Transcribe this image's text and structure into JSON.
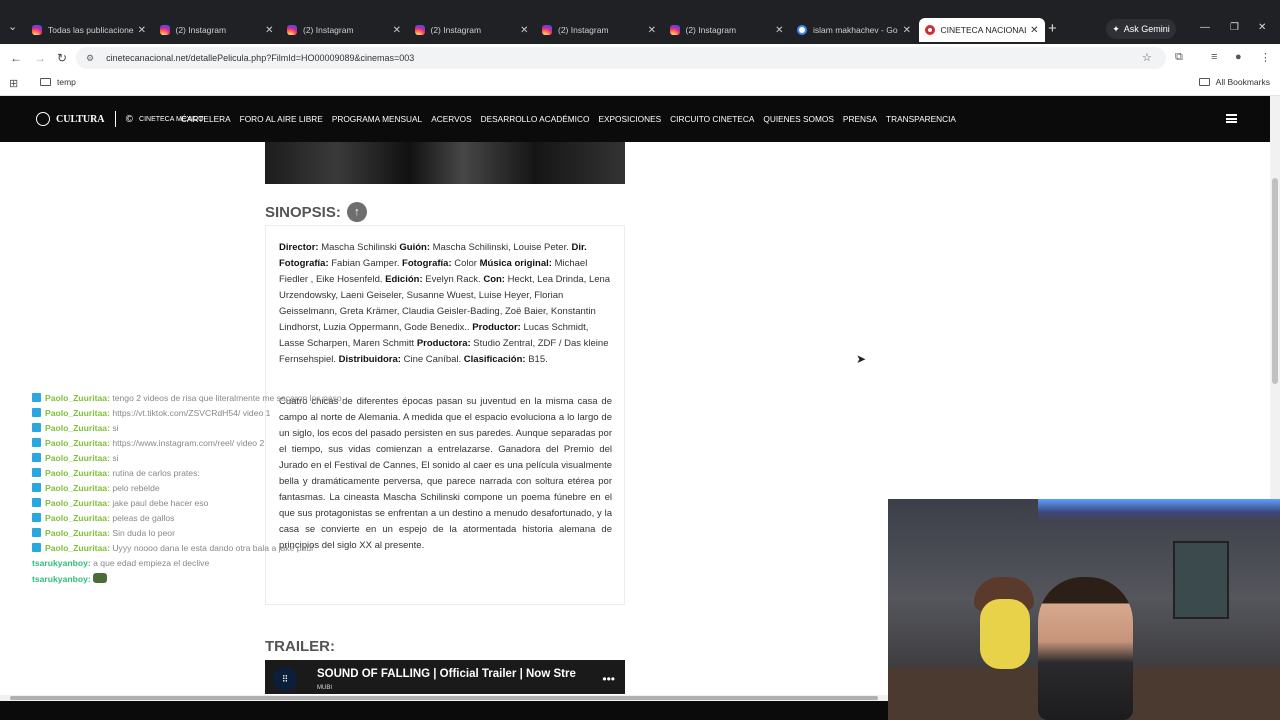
{
  "browser": {
    "tabs": [
      {
        "title": "Todas las publicaciones",
        "icon": "instagram-icon",
        "kind": "ig"
      },
      {
        "title": "(2) Instagram",
        "icon": "instagram-icon",
        "kind": "ig"
      },
      {
        "title": "(2) Instagram",
        "icon": "instagram-icon",
        "kind": "ig"
      },
      {
        "title": "(2) Instagram",
        "icon": "instagram-icon",
        "kind": "ig"
      },
      {
        "title": "(2) Instagram",
        "icon": "instagram-icon",
        "kind": "ig"
      },
      {
        "title": "(2) Instagram",
        "icon": "instagram-icon",
        "kind": "ig"
      },
      {
        "title": "islam makhachev - Go",
        "icon": "google-icon",
        "kind": "g"
      },
      {
        "title": "CINETECA NACIONAL",
        "icon": "cineteca-icon",
        "kind": "cn",
        "active": true
      }
    ],
    "ask_gemini": "Ask Gemini",
    "url": "cinetecanacional.net/detallePelicula.php?FilmId=HO00009089&cinemas=003",
    "bookmark_folder": "temp",
    "all_bookmarks": "All Bookmarks"
  },
  "site": {
    "logo_text": "CULTURA",
    "logo_sub": "CINETECA MÉXICO",
    "menu": [
      "CARTELERA",
      "FORO AL AIRE LIBRE",
      "PROGRAMA MENSUAL",
      "ACERVOS",
      "DESARROLLO ACADÉMICO",
      "EXPOSICIONES",
      "CIRCUITO CINETECA",
      "QUIENES SOMOS",
      "PRENSA",
      "TRANSPARENCIA"
    ]
  },
  "synopsis": {
    "heading": "SINOPSIS:",
    "credits": [
      {
        "label": "Director:",
        "value": " Mascha Schilinski "
      },
      {
        "label": "Guión:",
        "value": " Mascha Schilinski, Louise Peter. "
      },
      {
        "label": "Dir. Fotografía:",
        "value": " Fabian Gamper.  "
      },
      {
        "label": "Fotografía:",
        "value": " Color  "
      },
      {
        "label": "Música original:",
        "value": " Michael Fiedler , Eike Hosenfeld. "
      },
      {
        "label": "Edición:",
        "value": " Evelyn Rack. "
      },
      {
        "label": "Con:",
        "value": " Heckt, Lea Drinda, Lena Urzendowsky, Laeni Geiseler, Susanne Wuest, Luise Heyer, Florian Geisselmann, Greta Krämer, Claudia Geisler-Bading, Zoë Baier, Konstantin Lindhorst, Luzia Oppermann, Gode Benedix..  "
      },
      {
        "label": "Productor:",
        "value": " Lucas Schmidt, Lasse Scharpen, Maren Schmitt "
      },
      {
        "label": "Productora:",
        "value": " Studio Zentral, ZDF / Das kleine Fernsehspiel. "
      },
      {
        "label": "Distribuidora:",
        "value": " Cine Caníbal. "
      },
      {
        "label": "Clasificación:",
        "value": " B15."
      }
    ],
    "plot": "Cuatro chicas de diferentes épocas pasan su juventud en la misma casa de campo al norte de Alemania. A medida que el espacio evoluciona a lo largo de un siglo, los ecos del pasado persisten en sus paredes. Aunque separadas por el tiempo, sus vidas comienzan a entrelazarse. Ganadora del Premio del Jurado en el Festival de Cannes, El sonido al caer es una película visualmente bella y dramáticamente perversa, que parece narrada con soltura etérea por fantasmas. La cineasta Mascha Schilinski compone un poema fúnebre en el que sus protagonistas se enfrentan a un destino a menudo desafortunado, y la casa se convierte en un espejo de la atormentada historia alemana de principios del siglo XX al presente."
  },
  "trailer": {
    "heading": "TRAILER:",
    "video_title": "SOUND OF FALLING | Official Trailer | Now Stre",
    "channel": "MUBI"
  },
  "chat": [
    {
      "user": "Paolo_Zuuritaa:",
      "text": "tengo 2 videos de risa que literalmente me sacaron los paso",
      "u": 1
    },
    {
      "user": "Paolo_Zuuritaa:",
      "text": "https://vt.tiktok.com/ZSVCRdH54/ video 1",
      "u": 1
    },
    {
      "user": "Paolo_Zuuritaa:",
      "text": "si",
      "u": 1
    },
    {
      "user": "Paolo_Zuuritaa:",
      "text": "https://www.instagram.com/reel/ video 2",
      "u": 1
    },
    {
      "user": "Paolo_Zuuritaa:",
      "text": "si",
      "u": 1
    },
    {
      "user": "Paolo_Zuuritaa:",
      "text": "rutina de carlos prates:",
      "u": 1
    },
    {
      "user": "Paolo_Zuuritaa:",
      "text": "pelo rebelde",
      "u": 1
    },
    {
      "user": "Paolo_Zuuritaa:",
      "text": "jake paul debe hacer eso",
      "u": 1
    },
    {
      "user": "Paolo_Zuuritaa:",
      "text": "peleas de gallos",
      "u": 1
    },
    {
      "user": "Paolo_Zuuritaa:",
      "text": "Sin duda lo peor",
      "u": 1
    },
    {
      "user": "Paolo_Zuuritaa:",
      "text": "Uyyy noooo dana le esta dando otra bala a jake paul",
      "u": 1
    },
    {
      "user": "tsarukyanboy:",
      "text": "a que edad empieza el declive",
      "u": 2
    },
    {
      "user": "tsarukyanboy:",
      "text": "",
      "u": 2,
      "emote": true
    }
  ]
}
